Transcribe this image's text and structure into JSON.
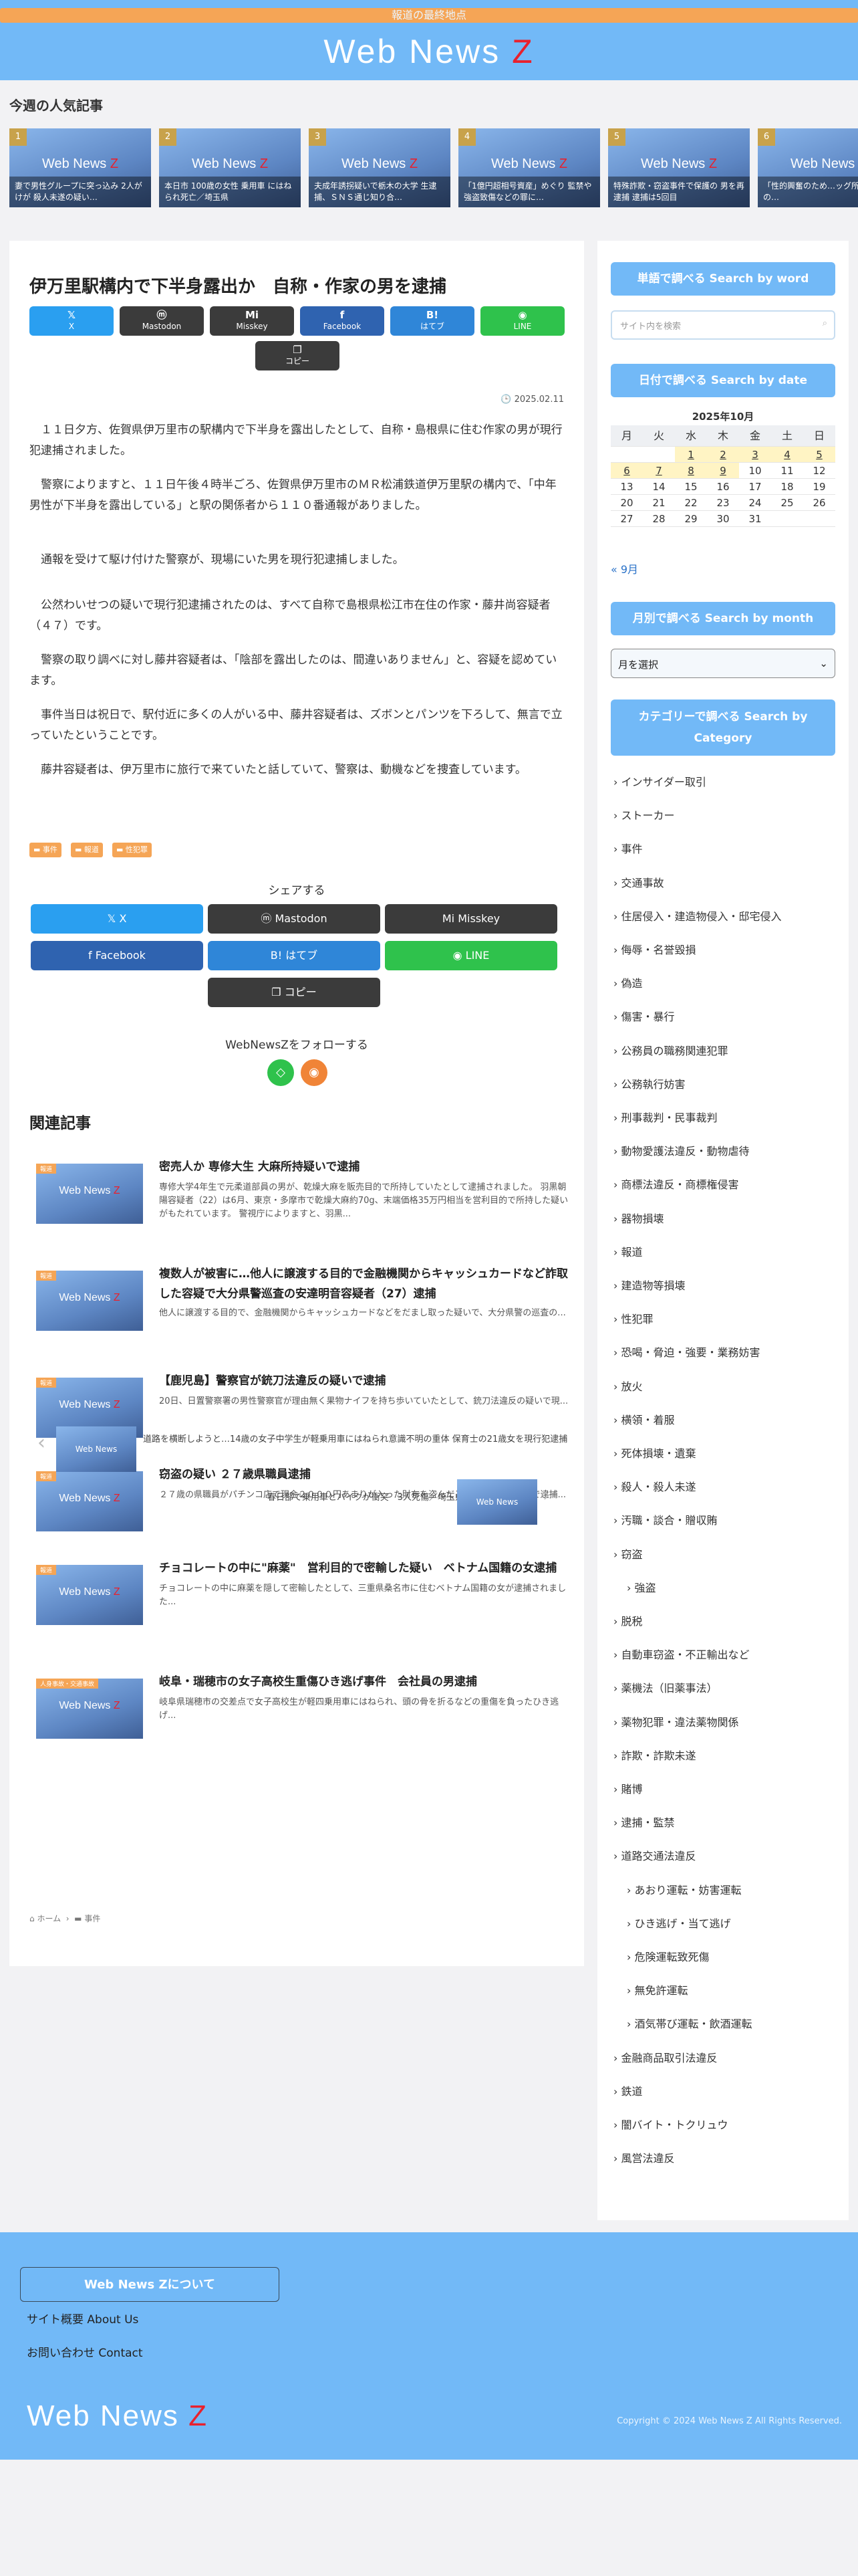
{
  "header": {
    "tagline": "報道の最終地点",
    "logo_main": "Web News ",
    "logo_z": "Z"
  },
  "popular": {
    "title": "今週の人気記事",
    "thumb_main": "Web News ",
    "thumb_z": "Z",
    "items": [
      {
        "rank": "1",
        "caption": "妻で男性グループに突っ込み 2人がけが 殺人未遂の疑い…"
      },
      {
        "rank": "2",
        "caption": "本日市 100歳の女性 乗用車 にはねられ死亡／埼玉県"
      },
      {
        "rank": "3",
        "caption": "夫成年誘拐疑いで栃木の大学 生逮捕、ＳＮＳ通じ知り合…"
      },
      {
        "rank": "4",
        "caption": "「1億円超相号資産」めぐり 監禁や強盗致傷などの罪に…"
      },
      {
        "rank": "5",
        "caption": "特殊詐欺・窃盗事件で保護の 男を再逮捕 逮捕は5回目"
      },
      {
        "rank": "6",
        "caption": "「性的興奮のため…ッグ所持、容疑の…"
      }
    ]
  },
  "article": {
    "title": "伊万里駅構内で下半身露出か　自称・作家の男を逮捕",
    "share_top": {
      "x": "X",
      "mastodon": "Mastodon",
      "misskey": "Misskey",
      "facebook": "Facebook",
      "hatebu": "はてブ",
      "line": "LINE",
      "copy": "コピー"
    },
    "date": "2025.02.11",
    "paragraphs": [
      "１１日夕方、佐賀県伊万里市の駅構内で下半身を露出したとして、自称・島根県に住む作家の男が現行犯逮捕されました。",
      "警察によりますと、１１日午後４時半ごろ、佐賀県伊万里市のＭＲ松浦鉄道伊万里駅の構内で、「中年男性が下半身を露出している」と駅の関係者から１１０番通報がありました。",
      "通報を受けて駆け付けた警察が、現場にいた男を現行犯逮捕しました。",
      "公然わいせつの疑いで現行犯逮捕されたのは、すべて自称で島根県松江市在住の作家・藤井尚容疑者（４７）です。",
      "警察の取り調べに対し藤井容疑者は、「陰部を露出したのは、間違いありません」と、容疑を認めています。",
      "事件当日は祝日で、駅付近に多くの人がいる中、藤井容疑者は、ズボンとパンツを下ろして、無言で立っていたということです。",
      "藤井容疑者は、伊万里市に旅行で来ていたと話していて、警察は、動機などを捜査しています。"
    ],
    "tags": [
      "事件",
      "報道",
      "性犯罪"
    ],
    "share_title": "シェアする",
    "share_bottom": {
      "x": "X",
      "mastodon": "Mastodon",
      "misskey": "Misskey",
      "facebook": "Facebook",
      "hatebu": "はてブ",
      "line": "LINE",
      "copy": "コピー"
    },
    "follow_title": "WebNewsZをフォローする",
    "related_title": "関連記事",
    "related": [
      {
        "cat": "報道",
        "title": "密売人か 専修大生 大麻所持疑いで逮捕",
        "summary": "専修大学4年生で元柔道部員の男が、乾燥大麻を販売目的で所持していたとして逮捕されました。 羽黒朝陽容疑者（22）は6月、東京・多摩市で乾燥大麻約70g、末端価格35万円相当を営利目的で所持した疑いがもたれています。 警視庁によりますと、羽黒..."
      },
      {
        "cat": "報道",
        "title": "複数人が被害に…他人に譲渡する目的で金融機関からキャッシュカードなど詐取した容疑で大分県警巡査の安達明音容疑者（27）逮捕",
        "summary": "他人に譲渡する目的で、金融機関からキャッシュカードなどをだまし取った疑いで、大分県警の巡査の..."
      },
      {
        "cat": "報道",
        "title": "【鹿児島】警察官が銃刀法違反の疑いで逮捕",
        "summary": "20日、日置警察署の男性警察官が理由無く果物ナイフを持ち歩いていたとして、銃刀法違反の疑いで現..."
      },
      {
        "cat": "報道",
        "title": "窃盗の疑い ２７歳県職員逮捕",
        "summary": "２７歳の県職員がパチンコ店で現金２０００円あまりが入った財布を盗んだとして、窃盗の疑いで逮捕..."
      },
      {
        "cat": "報道",
        "title": "チョコレートの中に\"麻薬\"　営利目的で密輸した疑い　ベトナム国籍の女逮捕",
        "summary": "チョコレートの中に麻薬を隠して密輸したとして、三重県桑名市に住むベトナム国籍の女が逮捕されました..."
      },
      {
        "cat": "人身事故・交通事故",
        "title": "岐阜・瑞穂市の女子高校生重傷ひき逃げ事件　会社員の男逮捕",
        "summary": "岐阜県瑞穂市の交差点で女子高校生が軽四乗用車にはねられ、頭の骨を折るなどの重傷を負ったひき逃げ..."
      }
    ],
    "prev_title": "道路を横断しようと…14歳の女子中学生が軽乗用車にはねられ意識不明の重体 保育士の21歳女を現行犯逮捕",
    "next_title": "春日部で乗用車とバイクが衝突　3人死傷／埼玉県",
    "thumb_label": "Web News",
    "breadcrumb": {
      "home": "ホーム",
      "cat": "事件"
    }
  },
  "sidebar": {
    "search_head": "単語で調べる Search by word",
    "search_placeholder": "サイト内を検索",
    "date_head": "日付で調べる Search by date",
    "calendar": {
      "caption": "2025年10月",
      "weekdays": [
        "月",
        "火",
        "水",
        "木",
        "金",
        "土",
        "日"
      ],
      "cells": [
        "",
        "",
        "1",
        "2",
        "3",
        "4",
        "5",
        "6",
        "7",
        "8",
        "9",
        "10",
        "11",
        "12",
        "13",
        "14",
        "15",
        "16",
        "17",
        "18",
        "19",
        "20",
        "21",
        "22",
        "23",
        "24",
        "25",
        "26",
        "27",
        "28",
        "29",
        "30",
        "31",
        "",
        ""
      ],
      "linked": [
        "1",
        "2",
        "3",
        "4",
        "5",
        "6",
        "7",
        "8",
        "9"
      ]
    },
    "prev_month": "« 9月",
    "month_head": "月別で調べる Search by month",
    "month_select": "月を選択",
    "cat_head": "カテゴリーで調べる Search by Category",
    "categories": [
      {
        "label": "インサイダー取引",
        "sub": false
      },
      {
        "label": "ストーカー",
        "sub": false
      },
      {
        "label": "事件",
        "sub": false
      },
      {
        "label": "交通事故",
        "sub": false
      },
      {
        "label": "住居侵入・建造物侵入・邸宅侵入",
        "sub": false
      },
      {
        "label": "侮辱・名誉毀損",
        "sub": false
      },
      {
        "label": "偽造",
        "sub": false
      },
      {
        "label": "傷害・暴行",
        "sub": false
      },
      {
        "label": "公務員の職務関連犯罪",
        "sub": false
      },
      {
        "label": "公務執行妨害",
        "sub": false
      },
      {
        "label": "刑事裁判・民事裁判",
        "sub": false
      },
      {
        "label": "動物愛護法違反・動物虐待",
        "sub": false
      },
      {
        "label": "商標法違反・商標権侵害",
        "sub": false
      },
      {
        "label": "器物損壊",
        "sub": false
      },
      {
        "label": "報道",
        "sub": false
      },
      {
        "label": "建造物等損壊",
        "sub": false
      },
      {
        "label": "性犯罪",
        "sub": false
      },
      {
        "label": "恐喝・脅迫・強要・業務妨害",
        "sub": false
      },
      {
        "label": "放火",
        "sub": false
      },
      {
        "label": "横領・着服",
        "sub": false
      },
      {
        "label": "死体損壊・遺棄",
        "sub": false
      },
      {
        "label": "殺人・殺人未遂",
        "sub": false
      },
      {
        "label": "汚職・談合・贈収賄",
        "sub": false
      },
      {
        "label": "窃盗",
        "sub": false
      },
      {
        "label": "強盗",
        "sub": true
      },
      {
        "label": "脱税",
        "sub": false
      },
      {
        "label": "自動車窃盗・不正輸出など",
        "sub": false
      },
      {
        "label": "薬機法（旧薬事法）",
        "sub": false
      },
      {
        "label": "薬物犯罪・違法薬物関係",
        "sub": false
      },
      {
        "label": "詐欺・詐欺未遂",
        "sub": false
      },
      {
        "label": "賭博",
        "sub": false
      },
      {
        "label": "逮捕・監禁",
        "sub": false
      },
      {
        "label": "道路交通法違反",
        "sub": false
      },
      {
        "label": "あおり運転・妨害運転",
        "sub": true
      },
      {
        "label": "ひき逃げ・当て逃げ",
        "sub": true
      },
      {
        "label": "危険運転致死傷",
        "sub": true
      },
      {
        "label": "無免許運転",
        "sub": true
      },
      {
        "label": "酒気帯び運転・飲酒運転",
        "sub": true
      },
      {
        "label": "金融商品取引法違反",
        "sub": false
      },
      {
        "label": "鉄道",
        "sub": false
      },
      {
        "label": "闇バイト・トクリュウ",
        "sub": false
      },
      {
        "label": "風営法違反",
        "sub": false
      }
    ]
  },
  "footer": {
    "about": "Web News Zについて",
    "links": [
      "サイト概要 About Us",
      "お問い合わせ Contact"
    ],
    "logo_main": "Web News ",
    "logo_z": "Z",
    "copyright": "Copyright © 2024 Web News Z All Rights Reserved."
  }
}
